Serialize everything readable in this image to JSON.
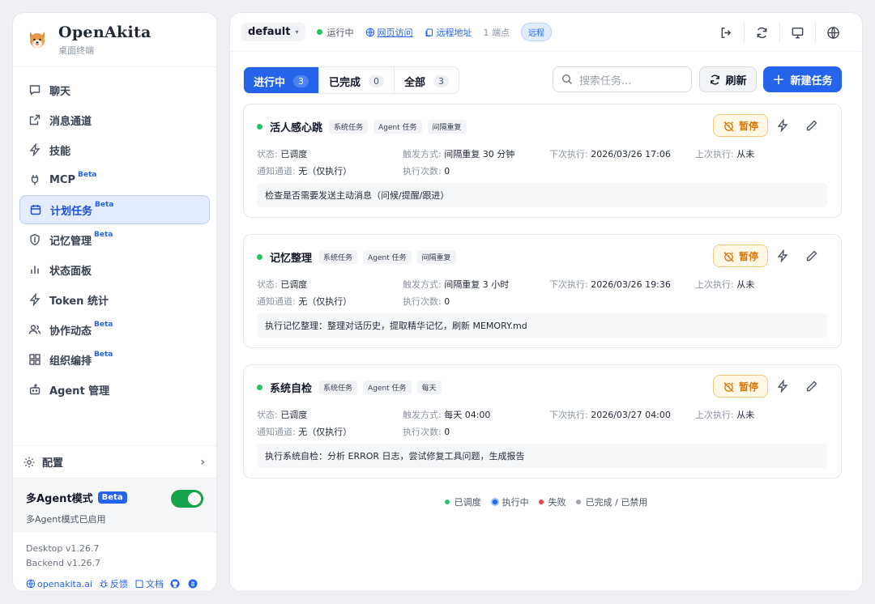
{
  "brand": {
    "name": "OpenAkita",
    "subtitle": "桌面终端"
  },
  "sidebar": {
    "items": [
      {
        "label": "聊天",
        "icon": "chat-icon"
      },
      {
        "label": "消息通道",
        "icon": "share-icon"
      },
      {
        "label": "技能",
        "icon": "bolt-icon"
      },
      {
        "label": "MCP",
        "icon": "plug-icon",
        "beta": "Beta"
      },
      {
        "label": "计划任务",
        "icon": "calendar-icon",
        "beta": "Beta",
        "active": true
      },
      {
        "label": "记忆管理",
        "icon": "shield-icon",
        "beta": "Beta"
      },
      {
        "label": "状态面板",
        "icon": "bar-chart-icon"
      },
      {
        "label": "Token 统计",
        "icon": "bolt-icon"
      },
      {
        "label": "协作动态",
        "icon": "users-icon",
        "beta": "Beta"
      },
      {
        "label": "组织编排",
        "icon": "grid-icon",
        "beta": "Beta"
      },
      {
        "label": "Agent 管理",
        "icon": "robot-icon"
      }
    ],
    "config_label": "配置",
    "multi_agent": {
      "title": "多Agent模式",
      "badge": "Beta",
      "desc": "多Agent模式已启用",
      "enabled": true
    },
    "versions": {
      "desktop": "Desktop v1.26.7",
      "backend": "Backend v1.26.7"
    },
    "links": {
      "site": "openakita.ai",
      "feedback": "反馈",
      "docs": "文档"
    }
  },
  "topbar": {
    "workspace": "default",
    "status": "运行中",
    "web_access": "网页访问",
    "remote_addr": "远程地址",
    "endpoints": "1 端点",
    "remote_pill": "远程"
  },
  "toolbar": {
    "tabs": [
      {
        "label": "进行中",
        "count": "3",
        "active": true
      },
      {
        "label": "已完成",
        "count": "0"
      },
      {
        "label": "全部",
        "count": "3"
      }
    ],
    "search_placeholder": "搜索任务...",
    "refresh_label": "刷新",
    "new_task_label": "新建任务"
  },
  "labels": {
    "status": "状态:",
    "trigger": "触发方式:",
    "next_run": "下次执行:",
    "last_run": "上次执行:",
    "notify": "通知通道:",
    "run_count": "执行次数:",
    "pause": "暂停"
  },
  "tasks": [
    {
      "name": "活人感心跳",
      "tags": [
        "系统任务",
        "Agent 任务",
        "间隔重复"
      ],
      "status": "已调度",
      "trigger": "间隔重复 30 分钟",
      "next_run": "2026/03/26 17:06",
      "last_run": "从未",
      "notify": "无（仅执行）",
      "run_count": "0",
      "description": "检查是否需要发送主动消息（问候/提醒/跟进）"
    },
    {
      "name": "记忆整理",
      "tags": [
        "系统任务",
        "Agent 任务",
        "间隔重复"
      ],
      "status": "已调度",
      "trigger": "间隔重复 3 小时",
      "next_run": "2026/03/26 19:36",
      "last_run": "从未",
      "notify": "无（仅执行）",
      "run_count": "0",
      "description": "执行记忆整理：整理对话历史，提取精华记忆，刷新 MEMORY.md"
    },
    {
      "name": "系统自检",
      "tags": [
        "系统任务",
        "Agent 任务",
        "每天"
      ],
      "status": "已调度",
      "trigger": "每天 04:00",
      "next_run": "2026/03/27 04:00",
      "last_run": "从未",
      "notify": "无（仅执行）",
      "run_count": "0",
      "description": "执行系统自检：分析 ERROR 日志，尝试修复工具问题，生成报告"
    }
  ],
  "legend": [
    {
      "label": "已调度",
      "color": "#22c55e"
    },
    {
      "label": "执行中",
      "color": "#2563eb"
    },
    {
      "label": "失败",
      "color": "#ef4444"
    },
    {
      "label": "已完成 / 已禁用",
      "color": "#9ca3af"
    }
  ],
  "colors": {
    "accent": "#2563eb",
    "success": "#22c55e",
    "warning": "#d97706"
  }
}
